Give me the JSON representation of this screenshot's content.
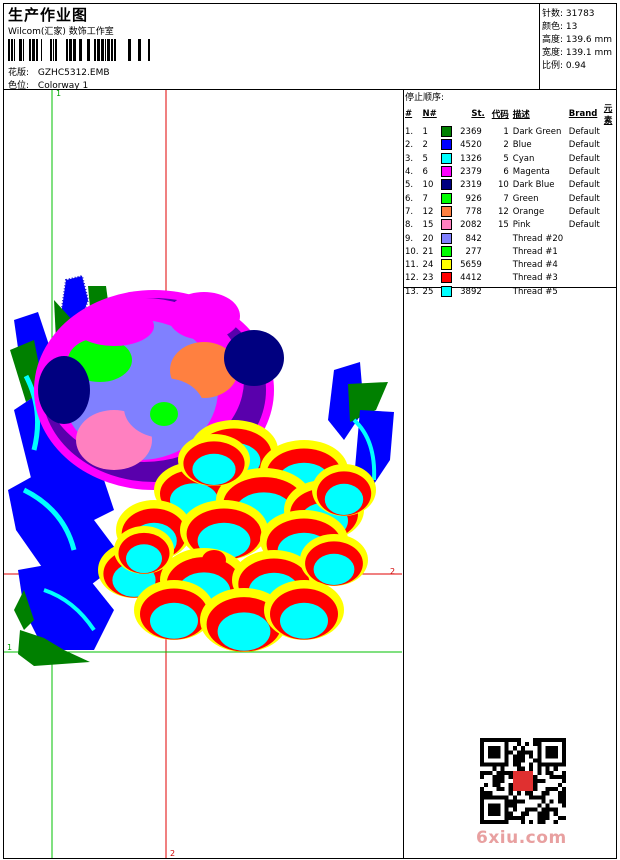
{
  "header": {
    "title": "生产作业图",
    "subtitle": "Wilcom(汇家) 数饰工作室",
    "design_label": "花版:",
    "design_value": "GZHC5312.EMB",
    "colorway_label": "色位:",
    "colorway_value": "Colorway 1"
  },
  "stats": {
    "stitches": "针数: 31783",
    "colors": "颜色: 13",
    "height": "高度: 139.6 mm",
    "width": "宽度: 139.1 mm",
    "scale": "比例: 0.94"
  },
  "sequence": {
    "title": "停止顺序:",
    "headers": [
      "#",
      "N#",
      "St.",
      "代码",
      "描述",
      "Brand",
      "元素"
    ],
    "rows": [
      {
        "n": "1.",
        "nn": "1",
        "color": "#008000",
        "st": "2369",
        "code": "1",
        "desc": "Dark Green",
        "brand": "Default"
      },
      {
        "n": "2.",
        "nn": "2",
        "color": "#0000ff",
        "st": "4520",
        "code": "2",
        "desc": "Blue",
        "brand": "Default"
      },
      {
        "n": "3.",
        "nn": "5",
        "color": "#00ffff",
        "st": "1326",
        "code": "5",
        "desc": "Cyan",
        "brand": "Default"
      },
      {
        "n": "4.",
        "nn": "6",
        "color": "#ff00ff",
        "st": "2379",
        "code": "6",
        "desc": "Magenta",
        "brand": "Default"
      },
      {
        "n": "5.",
        "nn": "10",
        "color": "#000080",
        "st": "2319",
        "code": "10",
        "desc": "Dark Blue",
        "brand": "Default"
      },
      {
        "n": "6.",
        "nn": "7",
        "color": "#00ff00",
        "st": "926",
        "code": "7",
        "desc": "Green",
        "brand": "Default"
      },
      {
        "n": "7.",
        "nn": "12",
        "color": "#ff8040",
        "st": "778",
        "code": "12",
        "desc": "Orange",
        "brand": "Default"
      },
      {
        "n": "8.",
        "nn": "15",
        "color": "#ff80c0",
        "st": "2082",
        "code": "15",
        "desc": "Pink",
        "brand": "Default"
      },
      {
        "n": "9.",
        "nn": "20",
        "color": "#8080ff",
        "st": "842",
        "code": "",
        "desc": "Thread #20",
        "brand": ""
      },
      {
        "n": "10.",
        "nn": "21",
        "color": "#00ff00",
        "st": "277",
        "code": "",
        "desc": "Thread #1",
        "brand": ""
      },
      {
        "n": "11.",
        "nn": "24",
        "color": "#ffff00",
        "st": "5659",
        "code": "",
        "desc": "Thread #4",
        "brand": ""
      },
      {
        "n": "12.",
        "nn": "23",
        "color": "#ff0000",
        "st": "4412",
        "code": "",
        "desc": "Thread #3",
        "brand": ""
      },
      {
        "n": "13.",
        "nn": "25",
        "color": "#00ffff",
        "st": "3892",
        "code": "",
        "desc": "Thread #5",
        "brand": ""
      }
    ]
  },
  "guides": {
    "label_1": "1",
    "label_2": "2"
  },
  "watermark": "6xiu.com"
}
